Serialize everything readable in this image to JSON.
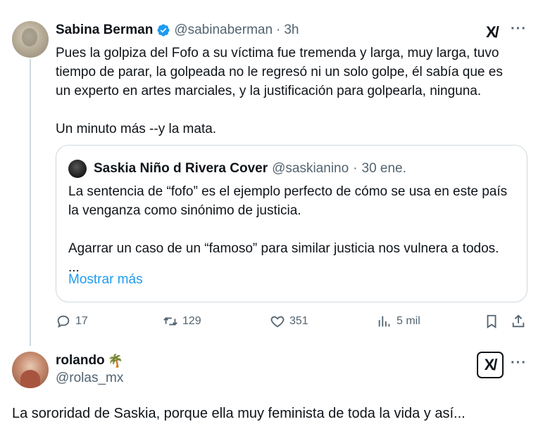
{
  "main_tweet": {
    "author_name": "Sabina Berman",
    "handle": "@sabinaberman",
    "separator": "·",
    "time": "3h",
    "paragraphs": [
      "Pues la golpiza del Fofo a su víctima fue tremenda y larga, muy larga, tuvo tiempo de parar, la golpeada no le regresó ni un solo golpe, él sabía que es un experto en artes marciales, y la justificación para golpearla, ninguna.",
      "Un minuto más --y la mata."
    ]
  },
  "quote": {
    "author_name": "Saskia Niño d Rivera Cover",
    "handle": "@saskianino",
    "separator": "·",
    "date": "30 ene.",
    "paragraphs": [
      "La sentencia de “fofo” es el ejemplo perfecto de cómo se usa en este país la venganza como sinónimo de justicia.",
      "Agarrar un caso de un “famoso” para similar justicia nos vulnera a todos. ..."
    ],
    "show_more": "Mostrar más"
  },
  "actions": {
    "replies": "17",
    "retweets": "129",
    "likes": "351",
    "views": "5 mil"
  },
  "reply": {
    "author_name": "rolando",
    "emoji": "🌴",
    "handle": "@rolas_mx",
    "text": "La sororidad de Saskia, porque ella muy feminista de toda la vida y así..."
  },
  "icons": {
    "verified": "verified-badge-icon",
    "grok": "grok-icon",
    "more": "more-icon",
    "reply": "reply-icon",
    "retweet": "retweet-icon",
    "like": "heart-icon",
    "views": "views-icon",
    "bookmark": "bookmark-icon",
    "share": "share-icon"
  },
  "colors": {
    "text": "#0f1419",
    "secondary": "#536471",
    "link": "#1d9bf0",
    "verified": "#1d9bf0",
    "border": "#cfd9de"
  }
}
